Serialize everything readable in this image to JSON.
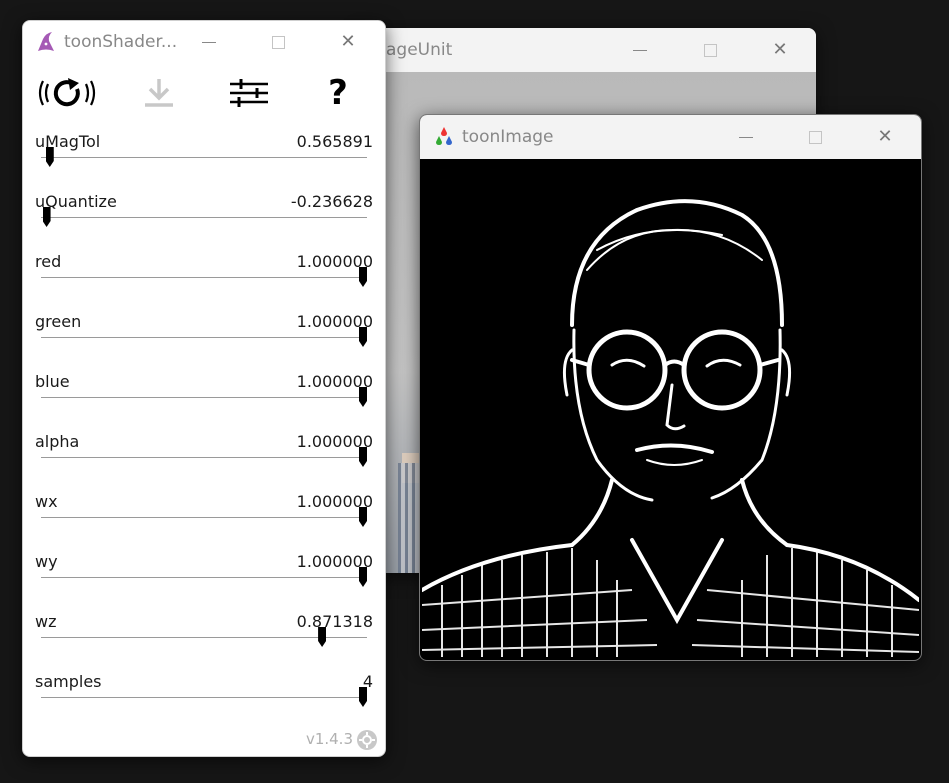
{
  "windows": {
    "back": {
      "title": "ageUnit"
    },
    "toon": {
      "title": "toonImage"
    },
    "panel": {
      "title": "toonShader...",
      "version": "v1.4.3",
      "params": [
        {
          "name": "uMagTol",
          "value": "0.565891",
          "level": 0.015
        },
        {
          "name": "uQuantize",
          "value": "-0.236628",
          "level": 0.005
        },
        {
          "name": "red",
          "value": "1.000000",
          "level": 1.0
        },
        {
          "name": "green",
          "value": "1.000000",
          "level": 1.0
        },
        {
          "name": "blue",
          "value": "1.000000",
          "level": 1.0
        },
        {
          "name": "alpha",
          "value": "1.000000",
          "level": 1.0
        },
        {
          "name": "wx",
          "value": "1.000000",
          "level": 1.0
        },
        {
          "name": "wy",
          "value": "1.000000",
          "level": 1.0
        },
        {
          "name": "wz",
          "value": "0.871318",
          "level": 0.871318
        },
        {
          "name": "samples",
          "value": "4",
          "level": 1.0
        }
      ]
    }
  },
  "icons": {
    "panel_app": "wizard-hat-icon",
    "toon_app": "colored-drops-icon",
    "reload": "reload-broadcast-icon",
    "download": "download-icon",
    "sliders": "sliders-icon",
    "help": "question-icon",
    "minimize": "minimize-icon",
    "maximize": "maximize-icon",
    "close": "close-icon",
    "settings_badge": "settings-badge-icon"
  },
  "glyphs": {
    "close": "✕",
    "help": "?"
  }
}
